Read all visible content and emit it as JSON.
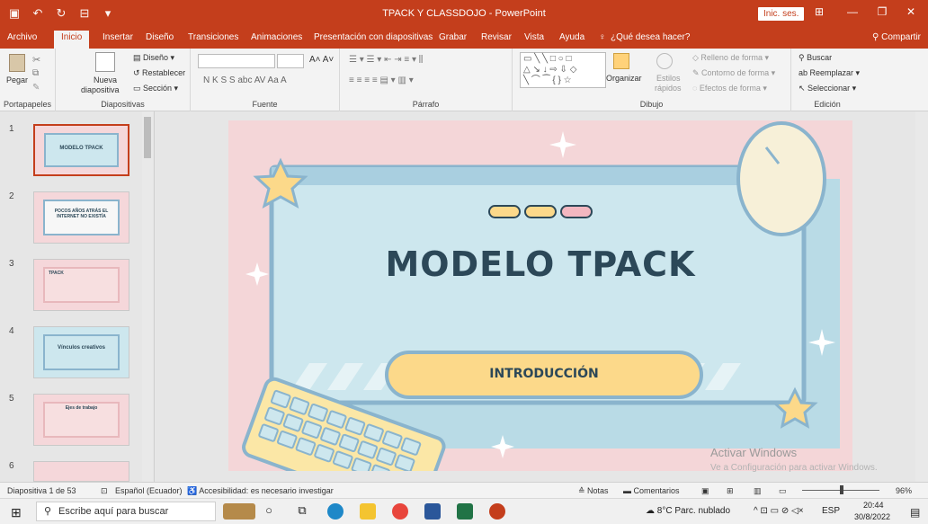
{
  "window": {
    "title": "TPACK Y CLASSDOJO - PowerPoint",
    "signin_label": "Inic. ses.",
    "share_label": "Compartir"
  },
  "tabs": [
    "Archivo",
    "Inicio",
    "Insertar",
    "Diseño",
    "Transiciones",
    "Animaciones",
    "Presentación con diapositivas",
    "Grabar",
    "Revisar",
    "Vista",
    "Ayuda",
    "¿Qué desea hacer?"
  ],
  "ribbon": {
    "groups": {
      "portapapeles": "Portapapeles",
      "diapositivas": "Diapositivas",
      "fuente": "Fuente",
      "parrafo": "Párrafo",
      "dibujo": "Dibujo",
      "edicion": "Edición"
    },
    "pegar": "Pegar",
    "nueva_1": "Nueva",
    "nueva_2": "diapositiva",
    "diseno": "Diseño",
    "restablecer": "Restablecer",
    "seccion": "Sección",
    "organizar": "Organizar",
    "estilos_1": "Estilos",
    "estilos_2": "rápidos",
    "relleno": "Relleno de forma",
    "contorno": "Contorno de forma",
    "efectos": "Efectos de forma",
    "buscar": "Buscar",
    "reemplazar": "Reemplazar",
    "seleccionar": "Seleccionar",
    "font_buttons": "N  K  S  S  abc  AV  Aa  A"
  },
  "thumbnails": [
    {
      "num": "1",
      "title": "MODELO TPACK"
    },
    {
      "num": "2",
      "title": "POCOS AÑOS ATRÁS EL INTERNET NO EXISTÍA"
    },
    {
      "num": "3",
      "title": "TPACK"
    },
    {
      "num": "4",
      "title": "Vínculos creativos"
    },
    {
      "num": "5",
      "title": "Ejes de trabajo"
    },
    {
      "num": "6",
      "title": ""
    }
  ],
  "slide": {
    "title": "MODELO TPACK",
    "button": "INTRODUCCIÓN"
  },
  "watermark": {
    "line1": "Activar Windows",
    "line2": "Ve a Configuración para activar Windows."
  },
  "status": {
    "slide_count": "Diapositiva 1 de 53",
    "language": "Español (Ecuador)",
    "accessibility": "Accesibilidad: es necesario investigar",
    "notes": "Notas",
    "comments": "Comentarios",
    "zoom": "96%"
  },
  "taskbar": {
    "search_placeholder": "Escribe aquí para buscar",
    "weather": "8°C  Parc. nublado",
    "lang": "ESP",
    "time": "20:44",
    "date": "30/8/2022"
  },
  "colors": {
    "accent": "#c43e1c",
    "slide_bg": "#f4d6d8",
    "panel": "#cde7ee",
    "title_text": "#2c4858",
    "button_fill": "#fcd98a"
  }
}
